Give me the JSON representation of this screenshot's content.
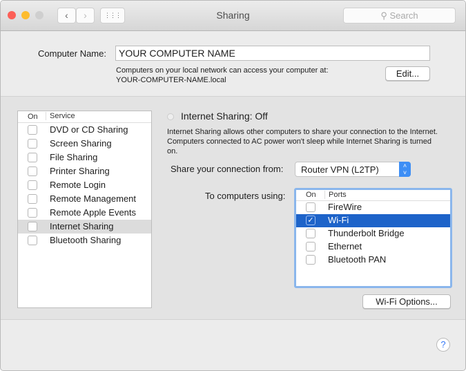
{
  "window": {
    "title": "Sharing",
    "search_placeholder": "Search",
    "colors": {
      "close": "#fc5f57",
      "minimize": "#fdbc2e",
      "selection": "#1d63c9",
      "focus": "#7fb0eb"
    }
  },
  "toolbar": {
    "back": "‹",
    "forward": "›",
    "grid": "⋮⋮⋮"
  },
  "computer_name": {
    "label": "Computer Name:",
    "value": "YOUR COMPUTER NAME",
    "info_line1": "Computers on your local network can access your computer at:",
    "info_line2": "YOUR-COMPUTER-NAME.local",
    "edit_label": "Edit..."
  },
  "services": {
    "col_on": "On",
    "col_service": "Service",
    "items": [
      {
        "label": "DVD or CD Sharing",
        "on": false
      },
      {
        "label": "Screen Sharing",
        "on": false
      },
      {
        "label": "File Sharing",
        "on": false
      },
      {
        "label": "Printer Sharing",
        "on": false
      },
      {
        "label": "Remote Login",
        "on": false
      },
      {
        "label": "Remote Management",
        "on": false
      },
      {
        "label": "Remote Apple Events",
        "on": false
      },
      {
        "label": "Internet Sharing",
        "on": false,
        "selected": true
      },
      {
        "label": "Bluetooth Sharing",
        "on": false
      }
    ]
  },
  "detail": {
    "status": "Internet Sharing: Off",
    "description": "Internet Sharing allows other computers to share your connection to the Internet. Computers connected to AC power won't sleep while Internet Sharing is turned on.",
    "share_from_label": "Share your connection from:",
    "share_from_value": "Router VPN (L2TP)",
    "to_label": "To computers using:",
    "ports_col_on": "On",
    "ports_col_ports": "Ports",
    "ports": [
      {
        "label": "FireWire",
        "on": false
      },
      {
        "label": "Wi-Fi",
        "on": true,
        "selected": true
      },
      {
        "label": "Thunderbolt Bridge",
        "on": false
      },
      {
        "label": "Ethernet",
        "on": false
      },
      {
        "label": "Bluetooth PAN",
        "on": false
      }
    ],
    "wifi_options": "Wi-Fi Options..."
  },
  "help": "?"
}
